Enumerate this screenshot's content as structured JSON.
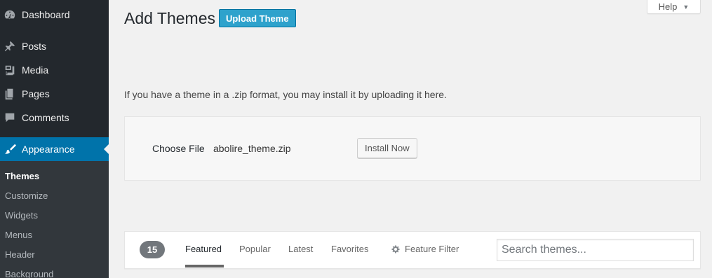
{
  "colors": {
    "sidebar_bg": "#23282d",
    "submenu_bg": "#32373c",
    "active_bg": "#0073aa",
    "primary_button": "#2ea2cc",
    "page_bg": "#f1f1f1"
  },
  "sidebar": {
    "items": [
      {
        "label": "Dashboard",
        "icon": "dashboard-icon"
      },
      {
        "label": "Posts",
        "icon": "pin-icon"
      },
      {
        "label": "Media",
        "icon": "media-icon"
      },
      {
        "label": "Pages",
        "icon": "pages-icon"
      },
      {
        "label": "Comments",
        "icon": "comment-icon"
      },
      {
        "label": "Appearance",
        "icon": "paintbrush-icon",
        "active": true
      }
    ],
    "submenu": [
      {
        "label": "Themes",
        "current": true
      },
      {
        "label": "Customize"
      },
      {
        "label": "Widgets"
      },
      {
        "label": "Menus"
      },
      {
        "label": "Header"
      },
      {
        "label": "Background"
      }
    ]
  },
  "header": {
    "title": "Add Themes",
    "upload_button": "Upload Theme",
    "help_label": "Help",
    "help_caret": "▼"
  },
  "upload": {
    "description": "If you have a theme in a .zip format, you may install it by uploading it here.",
    "choose_file_label": "Choose File",
    "file_name": "abolire_theme.zip",
    "install_button": "Install Now"
  },
  "filters": {
    "count": "15",
    "links": [
      "Featured",
      "Popular",
      "Latest",
      "Favorites"
    ],
    "current": "Featured",
    "feature_filter": "Feature Filter",
    "search_placeholder": "Search themes..."
  }
}
